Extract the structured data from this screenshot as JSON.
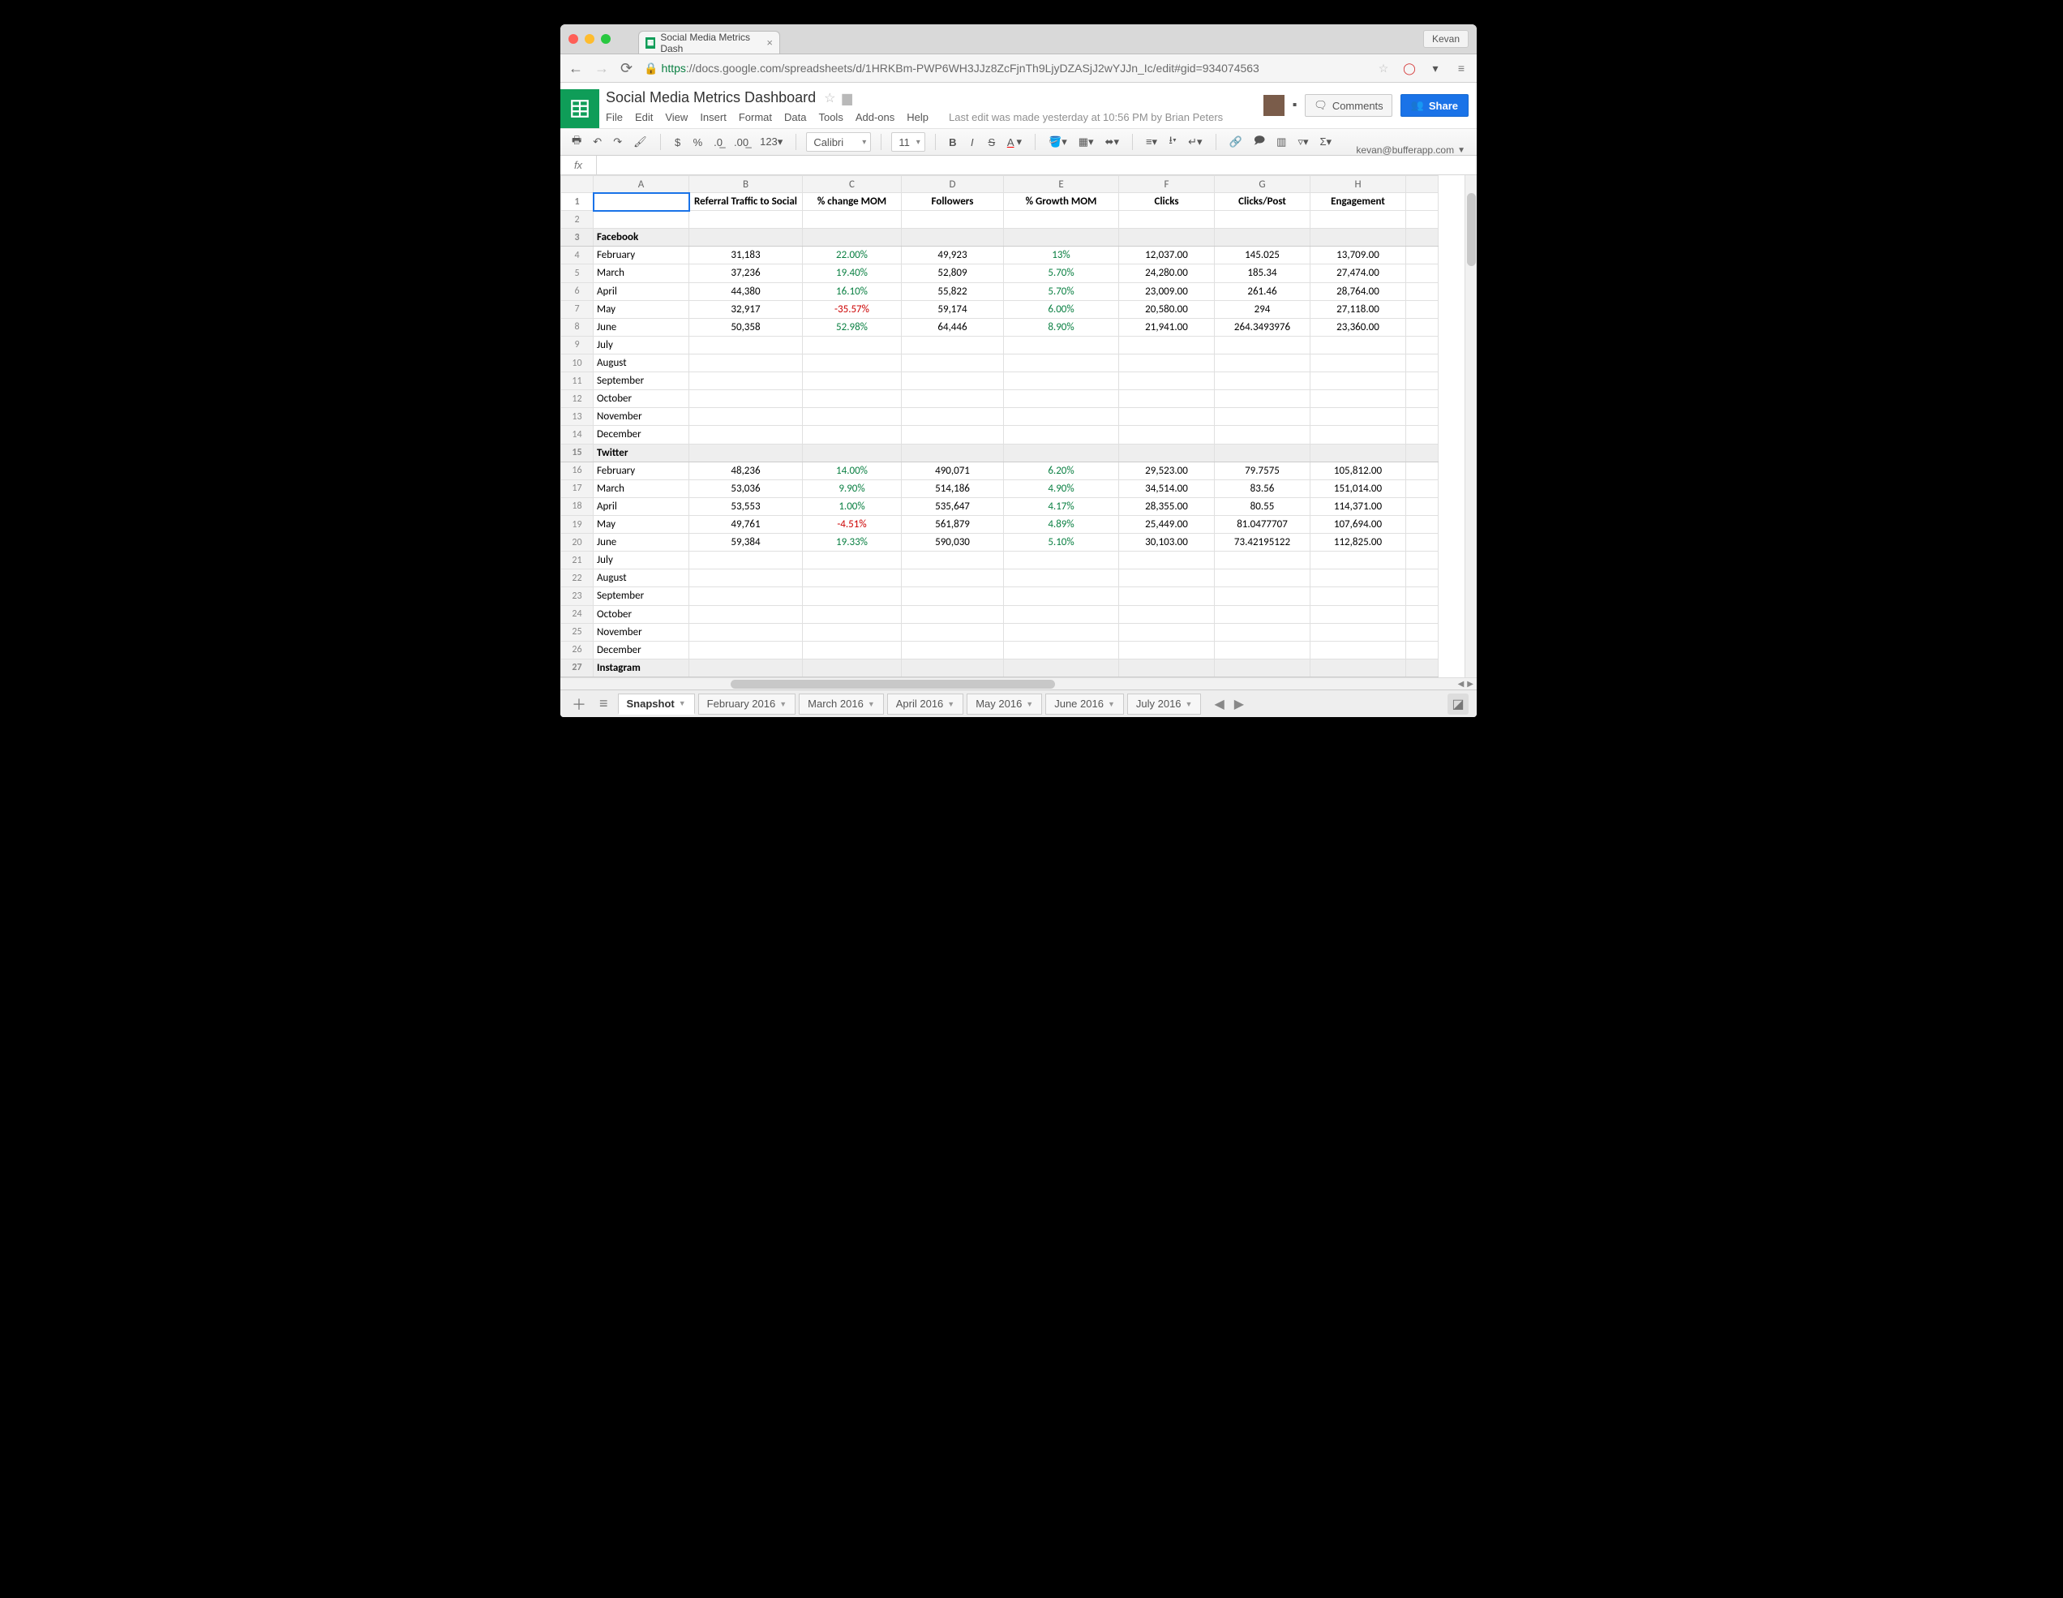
{
  "browser": {
    "tab_title": "Social Media Metrics Dash",
    "profile": "Kevan",
    "url_scheme": "https",
    "url_rest": "://docs.google.com/spreadsheets/d/1HRKBm-PWP6WH3JJz8ZcFjnTh9LjyDZASjJ2wYJJn_Ic/edit#gid=934074563"
  },
  "docs": {
    "account": "kevan@bufferapp.com",
    "title": "Social Media Metrics Dashboard",
    "menus": [
      "File",
      "Edit",
      "View",
      "Insert",
      "Format",
      "Data",
      "Tools",
      "Add-ons",
      "Help"
    ],
    "status": "Last edit was made yesterday at 10:56 PM by Brian Peters",
    "comments_label": "Comments",
    "share_label": "Share"
  },
  "toolbar": {
    "currency": "$",
    "percent": "%",
    "dec_dec": ".0̲",
    "inc_dec": ".00̲",
    "more_fmt": "123▾",
    "font": "Calibri",
    "font_size": "11"
  },
  "grid": {
    "cols": [
      "A",
      "B",
      "C",
      "D",
      "E",
      "F",
      "G",
      "H"
    ],
    "headers": [
      "",
      "Referral Traffic to Social",
      "% change MOM",
      "Followers",
      "% Growth MOM",
      "Clicks",
      "Clicks/Post",
      "Engagement"
    ],
    "rows": [
      {
        "n": 1,
        "type": "hdr"
      },
      {
        "n": 2,
        "type": "blank"
      },
      {
        "n": 3,
        "type": "section",
        "a": "Facebook"
      },
      {
        "n": 4,
        "a": "February",
        "b": "31,183",
        "c": "22.00%",
        "cc": "green",
        "d": "49,923",
        "e": "13%",
        "ec": "green",
        "f": "12,037.00",
        "g": "145.025",
        "h": "13,709.00"
      },
      {
        "n": 5,
        "a": "March",
        "b": "37,236",
        "c": "19.40%",
        "cc": "green",
        "d": "52,809",
        "e": "5.70%",
        "ec": "green",
        "f": "24,280.00",
        "g": "185.34",
        "h": "27,474.00"
      },
      {
        "n": 6,
        "a": "April",
        "b": "44,380",
        "c": "16.10%",
        "cc": "green",
        "d": "55,822",
        "e": "5.70%",
        "ec": "green",
        "f": "23,009.00",
        "g": "261.46",
        "h": "28,764.00"
      },
      {
        "n": 7,
        "a": "May",
        "b": "32,917",
        "c": "-35.57%",
        "cc": "red",
        "d": "59,174",
        "e": "6.00%",
        "ec": "green",
        "f": "20,580.00",
        "g": "294",
        "h": "27,118.00"
      },
      {
        "n": 8,
        "a": "June",
        "b": "50,358",
        "c": "52.98%",
        "cc": "green",
        "d": "64,446",
        "e": "8.90%",
        "ec": "green",
        "f": "21,941.00",
        "g": "264.3493976",
        "h": "23,360.00"
      },
      {
        "n": 9,
        "a": "July"
      },
      {
        "n": 10,
        "a": "August"
      },
      {
        "n": 11,
        "a": "September"
      },
      {
        "n": 12,
        "a": "October"
      },
      {
        "n": 13,
        "a": "November"
      },
      {
        "n": 14,
        "a": "December"
      },
      {
        "n": 15,
        "type": "section",
        "a": "Twitter"
      },
      {
        "n": 16,
        "a": "February",
        "b": "48,236",
        "c": "14.00%",
        "cc": "green",
        "d": "490,071",
        "e": "6.20%",
        "ec": "green",
        "f": "29,523.00",
        "g": "79.7575",
        "h": "105,812.00"
      },
      {
        "n": 17,
        "a": "March",
        "b": "53,036",
        "c": "9.90%",
        "cc": "green",
        "d": "514,186",
        "e": "4.90%",
        "ec": "green",
        "f": "34,514.00",
        "g": "83.56",
        "h": "151,014.00"
      },
      {
        "n": 18,
        "a": "April",
        "b": "53,553",
        "c": "1.00%",
        "cc": "green",
        "d": "535,647",
        "e": "4.17%",
        "ec": "green",
        "f": "28,355.00",
        "g": "80.55",
        "h": "114,371.00"
      },
      {
        "n": 19,
        "a": "May",
        "b": "49,761",
        "c": "-4.51%",
        "cc": "red",
        "d": "561,879",
        "e": "4.89%",
        "ec": "green",
        "f": "25,449.00",
        "g": "81.0477707",
        "h": "107,694.00"
      },
      {
        "n": 20,
        "a": "June",
        "b": "59,384",
        "c": "19.33%",
        "cc": "green",
        "d": "590,030",
        "e": "5.10%",
        "ec": "green",
        "f": "30,103.00",
        "g": "73.42195122",
        "h": "112,825.00"
      },
      {
        "n": 21,
        "a": "July"
      },
      {
        "n": 22,
        "a": "August"
      },
      {
        "n": 23,
        "a": "September"
      },
      {
        "n": 24,
        "a": "October"
      },
      {
        "n": 25,
        "a": "November"
      },
      {
        "n": 26,
        "a": "December"
      },
      {
        "n": 27,
        "type": "section",
        "a": "Instagram"
      }
    ]
  },
  "sheets": {
    "tabs": [
      {
        "label": "Snapshot",
        "active": true
      },
      {
        "label": "February 2016"
      },
      {
        "label": "March 2016"
      },
      {
        "label": "April 2016"
      },
      {
        "label": "May 2016"
      },
      {
        "label": "June 2016"
      },
      {
        "label": "July 2016"
      }
    ]
  }
}
